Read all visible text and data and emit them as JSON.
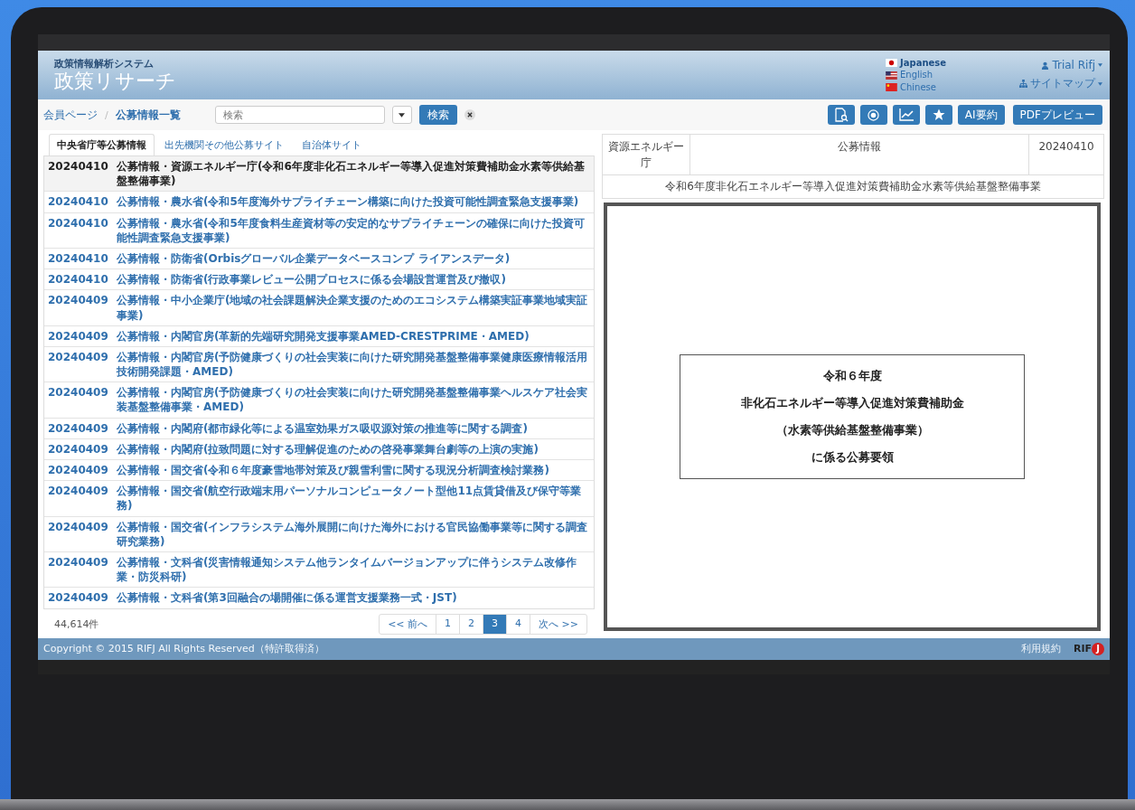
{
  "header": {
    "subtitle": "政策情報解析システム",
    "title": "政策リサーチ",
    "user": "Trial Rifj",
    "sitemap": "サイトマップ",
    "languages": [
      {
        "label": "Japanese",
        "kind": "jp",
        "selected": true
      },
      {
        "label": "English",
        "kind": "us",
        "selected": false
      },
      {
        "label": "Chinese",
        "kind": "cn",
        "selected": false
      }
    ]
  },
  "nav": {
    "breadcrumb": [
      "会員ページ",
      "公募情報一覧"
    ],
    "separator": "/",
    "search": {
      "placeholder": "検索"
    },
    "search_button": "検索",
    "toolbar": [
      {
        "kind": "doc-search"
      },
      {
        "kind": "target"
      },
      {
        "kind": "chart"
      },
      {
        "kind": "star"
      },
      {
        "kind": "text",
        "label": "AI要約"
      },
      {
        "kind": "text",
        "label": "PDFプレビュー"
      }
    ]
  },
  "tabs": [
    {
      "label": "中央省庁等公募情報",
      "selected": true
    },
    {
      "label": "出先機関その他公募サイト",
      "selected": false
    },
    {
      "label": "自治体サイト",
      "selected": false
    }
  ],
  "rows": [
    {
      "date": "20240410",
      "title": "公募情報・資源エネルギー庁(令和6年度非化石エネルギー等導入促進対策費補助金水素等供給基盤整備事業)",
      "selected": true
    },
    {
      "date": "20240410",
      "title": "公募情報・農水省(令和5年度海外サプライチェーン構築に向けた投資可能性調査緊急支援事業)",
      "selected": false
    },
    {
      "date": "20240410",
      "title": "公募情報・農水省(令和5年度食料生産資材等の安定的なサプライチェーンの確保に向けた投資可能性調査緊急支援事業)",
      "selected": false
    },
    {
      "date": "20240410",
      "title": "公募情報・防衛省(Orbisグローバル企業データベースコンプ ライアンスデータ)",
      "selected": false
    },
    {
      "date": "20240410",
      "title": "公募情報・防衛省(行政事業レビュー公開プロセスに係る会場設営運営及び撤収)",
      "selected": false
    },
    {
      "date": "20240409",
      "title": "公募情報・中小企業庁(地域の社会課題解決企業支援のためのエコシステム構築実証事業地域実証事業)",
      "selected": false
    },
    {
      "date": "20240409",
      "title": "公募情報・内閣官房(革新的先端研究開発支援事業AMED-CRESTPRIME・AMED)",
      "selected": false
    },
    {
      "date": "20240409",
      "title": "公募情報・内閣官房(予防健康づくりの社会実装に向けた研究開発基盤整備事業健康医療情報活用技術開発課題・AMED)",
      "selected": false
    },
    {
      "date": "20240409",
      "title": "公募情報・内閣官房(予防健康づくりの社会実装に向けた研究開発基盤整備事業ヘルスケア社会実装基盤整備事業・AMED)",
      "selected": false
    },
    {
      "date": "20240409",
      "title": "公募情報・内閣府(都市緑化等による温室効果ガス吸収源対策の推進等に関する調査)",
      "selected": false
    },
    {
      "date": "20240409",
      "title": "公募情報・内閣府(拉致問題に対する理解促進のための啓発事業舞台劇等の上演の実施)",
      "selected": false
    },
    {
      "date": "20240409",
      "title": "公募情報・国交省(令和６年度豪雪地帯対策及び親雪利雪に関する現況分析調査検討業務)",
      "selected": false
    },
    {
      "date": "20240409",
      "title": "公募情報・国交省(航空行政端末用パーソナルコンピュータノート型他11点賃貸借及び保守等業務)",
      "selected": false
    },
    {
      "date": "20240409",
      "title": "公募情報・国交省(インフラシステム海外展開に向けた海外における官民協働事業等に関する調査研究業務)",
      "selected": false
    },
    {
      "date": "20240409",
      "title": "公募情報・文科省(災害情報通知システム他ランタイムバージョンアップに伴うシステム改修作業・防災科研)",
      "selected": false
    },
    {
      "date": "20240409",
      "title": "公募情報・文科省(第3回融合の場開催に係る運営支援業務一式・JST)",
      "selected": false
    }
  ],
  "count": "44,614件",
  "pagination": [
    {
      "label": "<< 前へ",
      "selected": false
    },
    {
      "label": "1",
      "selected": false
    },
    {
      "label": "2",
      "selected": false
    },
    {
      "label": "3",
      "selected": true
    },
    {
      "label": "4",
      "selected": false
    },
    {
      "label": "次へ >>",
      "selected": false
    }
  ],
  "detail": {
    "agency": "資源エネルギー庁",
    "category": "公募情報",
    "date": "20240410",
    "title": "令和6年度非化石エネルギー等導入促進対策費補助金水素等供給基盤整備事業",
    "document_lines": [
      "令和６年度",
      "非化石エネルギー等導入促進対策費補助金",
      "（水素等供給基盤整備事業）",
      "に係る公募要領"
    ]
  },
  "footer": {
    "copyright": "Copyright © 2015 RIFJ All Rights Reserved（特許取得済）",
    "terms": "利用規約",
    "logo": "RIF",
    "logo_mark": "J"
  }
}
